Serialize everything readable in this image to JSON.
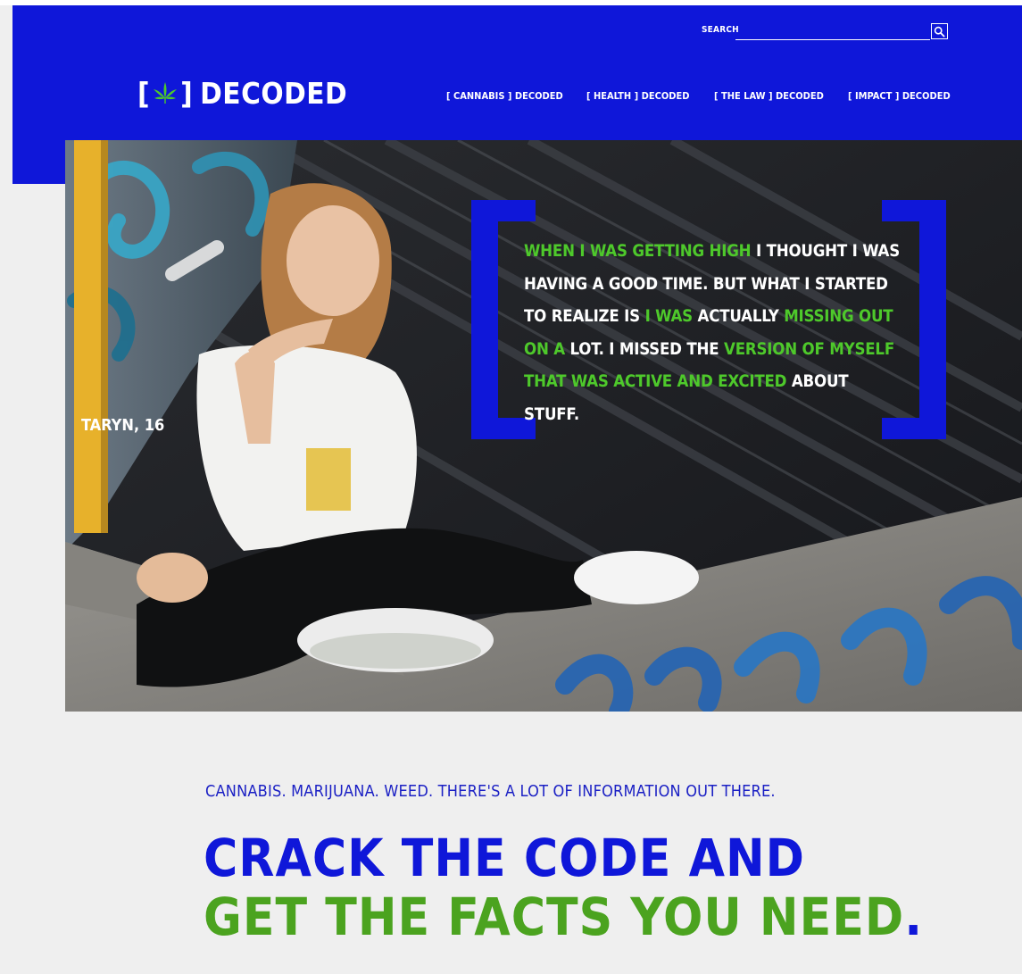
{
  "header": {
    "search_label": "SEARCH",
    "search_placeholder": "",
    "logo_open": "[",
    "logo_close": "]",
    "logo_text": "DECODED"
  },
  "nav": [
    {
      "label": "[ CANNABIS ] DECODED"
    },
    {
      "label": "[ HEALTH ] DECODED"
    },
    {
      "label": "[ THE LAW ] DECODED"
    },
    {
      "label": "[ IMPACT ] DECODED"
    }
  ],
  "hero": {
    "quote_parts": [
      {
        "text": "WHEN I WAS GETTING HIGH",
        "highlight": true
      },
      {
        "text": " I THOUGHT I WAS HAVING A GOOD TIME. BUT WHAT I STARTED TO REALIZE IS ",
        "highlight": false
      },
      {
        "text": "I WAS",
        "highlight": true
      },
      {
        "text": " ACTUALLY ",
        "highlight": false
      },
      {
        "text": "MISSING OUT ON A",
        "highlight": true
      },
      {
        "text": " LOT. I MISSED THE ",
        "highlight": false
      },
      {
        "text": "VERSION OF MYSELF THAT WAS ACTIVE AND EXCITED",
        "highlight": true
      },
      {
        "text": " ABOUT STUFF.",
        "highlight": false
      }
    ],
    "author": "TARYN, 16"
  },
  "intro": {
    "subtitle": "CANNABIS. MARIJUANA. WEED. THERE'S A LOT OF INFORMATION OUT THERE.",
    "title_line1": "CRACK THE CODE AND",
    "title_line2": "GET THE FACTS YOU NEED",
    "title_dot": "."
  },
  "colors": {
    "brand_blue": "#0f17d9",
    "brand_green": "#4ec92b",
    "title_green": "#4ba31f",
    "background": "#efefef"
  },
  "icons": {
    "search": "search-icon",
    "logo_leaf": "cannabis-leaf-icon"
  }
}
